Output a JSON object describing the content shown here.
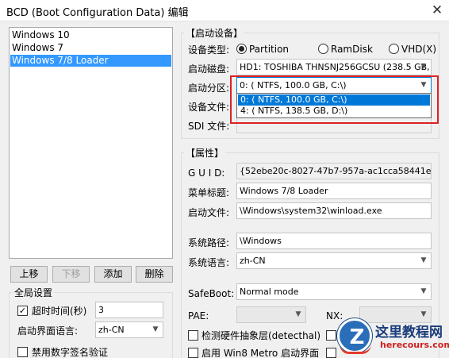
{
  "window": {
    "title": "BCD (Boot Configuration Data) 编辑",
    "close_glyph": "✕"
  },
  "os_list": {
    "items": [
      {
        "label": "Windows 10",
        "selected": false
      },
      {
        "label": "Windows 7",
        "selected": false
      },
      {
        "label": "Windows 7/8 Loader",
        "selected": true
      }
    ]
  },
  "list_buttons": {
    "up": "上移",
    "down": "下移",
    "add": "添加",
    "delete": "删除"
  },
  "global": {
    "title": "全局设置",
    "timeout_label": "超时时间(秒)",
    "timeout_checked": true,
    "timeout_value": "3",
    "ui_lang_label": "启动界面语言:",
    "ui_lang_value": "zh-CN",
    "disable_sig_label": "禁用数字签名验证",
    "disable_sig_checked": false
  },
  "boot_device": {
    "title": "【启动设备】",
    "type_label": "设备类型:",
    "type_options": [
      "Partition",
      "RamDisk",
      "VHD(X)"
    ],
    "type_selected": "Partition",
    "disk_label": "启动磁盘:",
    "disk_value": "HD1: TOSHIBA THNSNJ256GCSU (238.5 GB, C:",
    "partition_label": "启动分区:",
    "partition_value": "0: ( NTFS, 100.0 GB, C:\\)",
    "partition_options": [
      "0: ( NTFS, 100.0 GB, C:\\)",
      "4: ( NTFS, 138.5 GB, D:\\)"
    ],
    "partition_highlighted": 0,
    "device_file_label": "设备文件:",
    "sdi_label": "SDI 文件:"
  },
  "properties": {
    "title": "【属性】",
    "guid_label": "G U I D:",
    "guid_value": "{52ebe20c-8027-47b7-957a-ac1cca58441e}",
    "menu_title_label": "菜单标题:",
    "menu_title_value": "Windows 7/8 Loader",
    "boot_file_label": "启动文件:",
    "boot_file_value": "\\Windows\\system32\\winload.exe",
    "sys_path_label": "系统路径:",
    "sys_path_value": "\\Windows",
    "sys_lang_label": "系统语言:",
    "sys_lang_value": "zh-CN",
    "safeboot_label": "SafeBoot:",
    "safeboot_value": "Normal mode",
    "pae_label": "PAE:",
    "nx_label": "NX:",
    "detect_hal_label": "检测硬件抽象层(detecthal)",
    "detect_hal_checked": false,
    "metro_label": "启用 Win8 Metro 启动界面",
    "metro_checked": false
  },
  "watermark": {
    "line1": "这里教程网",
    "line2": "herecours.com",
    "logo_letter": "Z"
  },
  "colors": {
    "selection": "#3399ff",
    "highlight": "#d22222",
    "dropdown_selection": "#0078d7"
  }
}
